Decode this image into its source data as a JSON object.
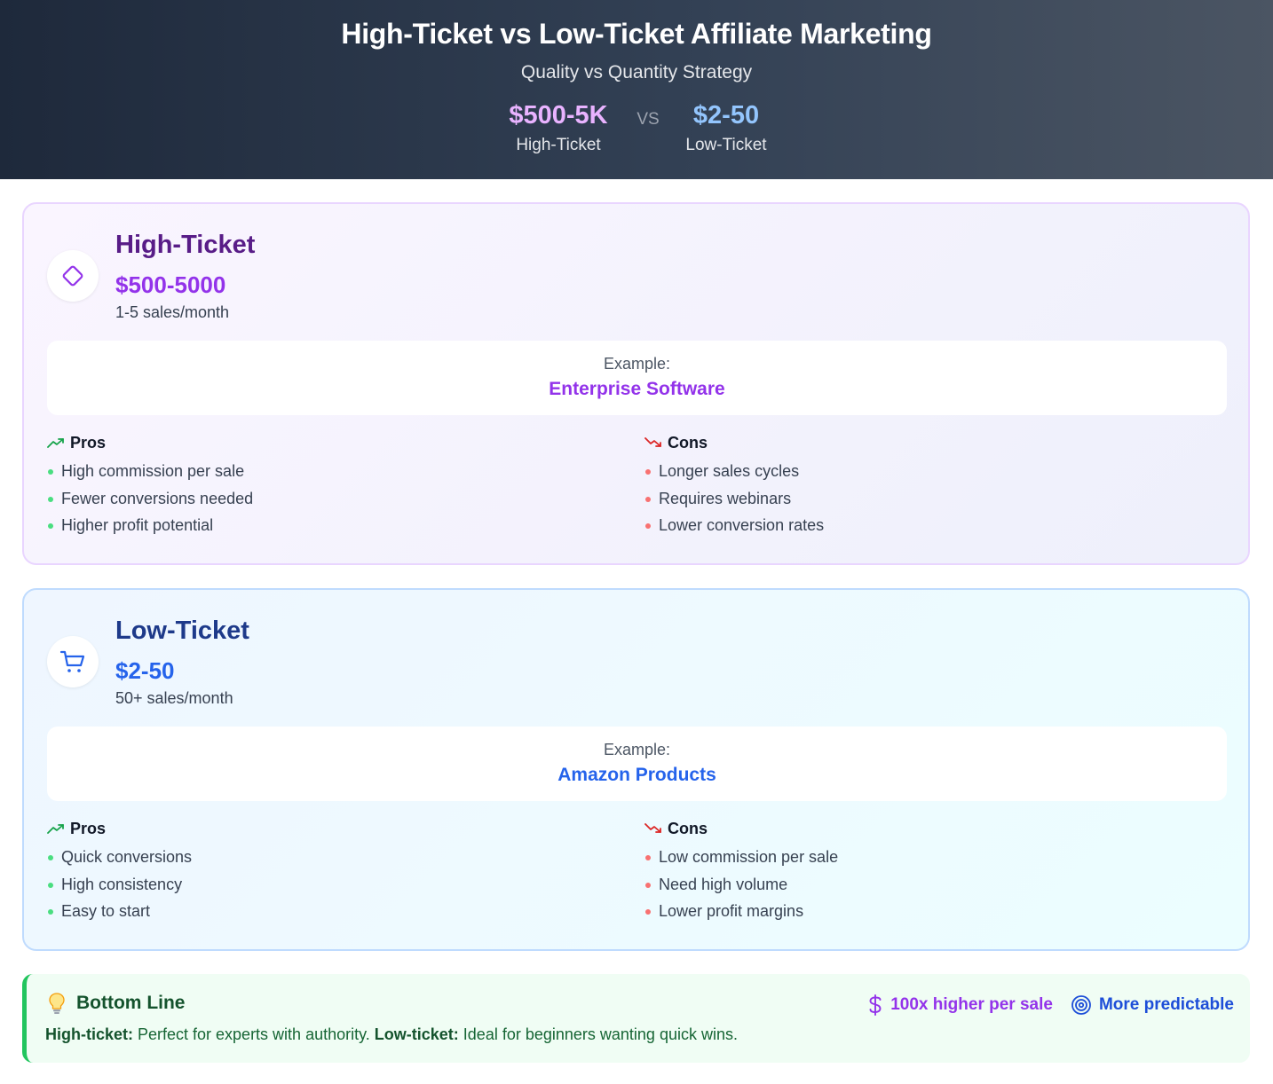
{
  "header": {
    "title": "High-Ticket vs Low-Ticket Affiliate Marketing",
    "subtitle": "Quality vs Quantity Strategy",
    "vs": "VS",
    "high_stat": {
      "value": "$500-5K",
      "label": "High-Ticket"
    },
    "low_stat": {
      "value": "$2-50",
      "label": "Low-Ticket"
    }
  },
  "cards": {
    "high": {
      "icon": "diamond-icon",
      "name": "High-Ticket",
      "price": "$500-5000",
      "frequency": "1-5 sales/month",
      "example_label": "Example:",
      "example_value": "Enterprise Software",
      "pros_title": "Pros",
      "pros": [
        "High commission per sale",
        "Fewer conversions needed",
        "Higher profit potential"
      ],
      "cons_title": "Cons",
      "cons": [
        "Longer sales cycles",
        "Requires webinars",
        "Lower conversion rates"
      ]
    },
    "low": {
      "icon": "shopping-cart-icon",
      "name": "Low-Ticket",
      "price": "$2-50",
      "frequency": "50+ sales/month",
      "example_label": "Example:",
      "example_value": "Amazon Products",
      "pros_title": "Pros",
      "pros": [
        "Quick conversions",
        "High consistency",
        "Easy to start"
      ],
      "cons_title": "Cons",
      "cons": [
        "Low commission per sale",
        "Need high volume",
        "Lower profit margins"
      ]
    }
  },
  "bottom_line": {
    "icon": "lightbulb-icon",
    "title": "Bottom Line",
    "high_label": "High-ticket:",
    "high_text": " Perfect for experts with authority. ",
    "low_label": "Low-ticket:",
    "low_text": " Ideal for beginners wanting quick wins.",
    "tag1": "100x higher per sale",
    "tag2": "More predictable"
  },
  "colors": {
    "high_accent": "#9333ea",
    "low_accent": "#2563eb",
    "pro_dot": "#4ade80",
    "con_dot": "#f87171",
    "bottom_accent": "#22c55e"
  }
}
